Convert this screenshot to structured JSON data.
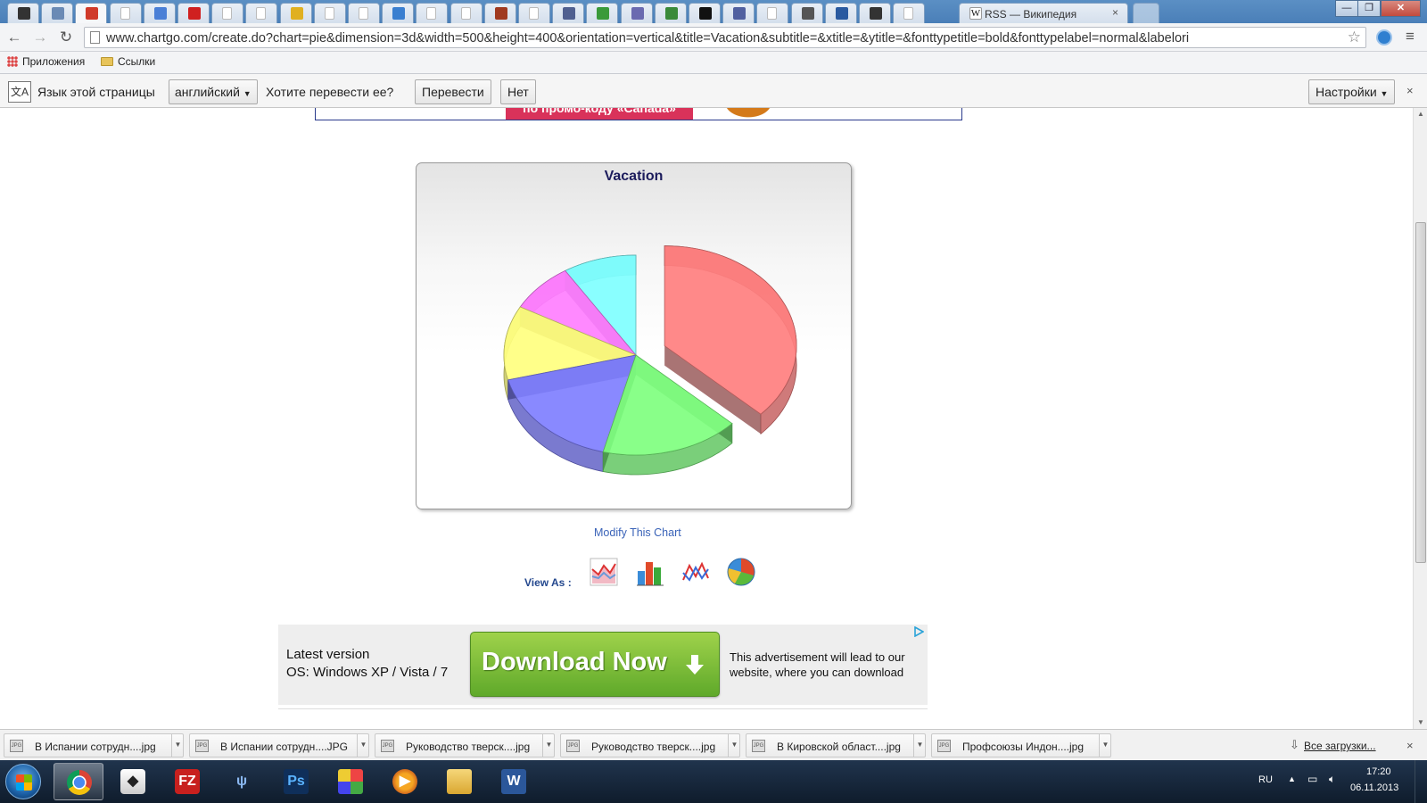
{
  "browser": {
    "tabs": [
      {
        "icon": "github-icon",
        "color": "#333333"
      },
      {
        "icon": "cloud-icon",
        "color": "#6a8ab5"
      },
      {
        "icon": "chartgo-icon",
        "color": "#d03a2a",
        "active": true
      },
      {
        "icon": "page-icon",
        "color": "#bbbbbb"
      },
      {
        "icon": "google-icon",
        "color": "#4a7fd6"
      },
      {
        "icon": "yandex-icon",
        "color": "#d02020"
      },
      {
        "icon": "page-icon",
        "color": "#bbbbbb"
      },
      {
        "icon": "page-icon",
        "color": "#bbbbbb"
      },
      {
        "icon": "yellow-square-icon",
        "color": "#e0b020"
      },
      {
        "icon": "page-icon",
        "color": "#bbbbbb"
      },
      {
        "icon": "page-icon",
        "color": "#bbbbbb"
      },
      {
        "icon": "translate-icon",
        "color": "#3a7fd0"
      },
      {
        "icon": "page-icon",
        "color": "#bbbbbb"
      },
      {
        "icon": "page-icon",
        "color": "#bbbbbb"
      },
      {
        "icon": "grid-icon",
        "color": "#a03a20"
      },
      {
        "icon": "page-icon",
        "color": "#bbbbbb"
      },
      {
        "icon": "php-icon",
        "color": "#506090"
      },
      {
        "icon": "puzzle-icon",
        "color": "#3a9a3a"
      },
      {
        "icon": "php-icon",
        "color": "#6a6ab0"
      },
      {
        "icon": "check-icon",
        "color": "#3a8a3a"
      },
      {
        "icon": "p-icon",
        "color": "#111111"
      },
      {
        "icon": "eye-icon",
        "color": "#5060a0"
      },
      {
        "icon": "page-icon",
        "color": "#bbbbbb"
      },
      {
        "icon": "cloud-icon",
        "color": "#555555"
      },
      {
        "icon": "circle-icon",
        "color": "#2a5aa0"
      },
      {
        "icon": "dark-square-icon",
        "color": "#333333"
      },
      {
        "icon": "page-icon",
        "color": "#bbbbbb"
      }
    ],
    "wiki_tab": {
      "label": "RSS — Википедия",
      "close": "×"
    },
    "url": "www.chartgo.com/create.do?chart=pie&dimension=3d&width=500&height=400&orientation=vertical&title=Vacation&subtitle=&xtitle=&ytitle=&fonttypetitle=bold&fonttypelabel=normal&labelori"
  },
  "bookmarks": {
    "apps": "Приложения",
    "links": "Ссылки"
  },
  "translate_bar": {
    "page_language_label": "Язык этой страницы",
    "language_value": "английский",
    "question": "Хотите перевести ее?",
    "translate_button": "Перевести",
    "no_button": "Нет",
    "settings_button": "Настройки",
    "close": "×"
  },
  "top_banner": {
    "promo_text": "по промо-коду «Canada»"
  },
  "chart_data": {
    "type": "pie",
    "dimension": "3d",
    "title": "Vacation",
    "slices": [
      {
        "value": 37,
        "color": "#ff7f7f",
        "exploded": true
      },
      {
        "value": 17,
        "color": "#7fff7f"
      },
      {
        "value": 17,
        "color": "#7f7fff"
      },
      {
        "value": 12,
        "color": "#ffff7f"
      },
      {
        "value": 8,
        "color": "#ff7fff"
      },
      {
        "value": 9,
        "color": "#7fffff"
      }
    ]
  },
  "page": {
    "modify_link": "Modify This Chart",
    "view_as_label": "View As :",
    "view_as_icons": [
      "area-chart-icon",
      "bar-chart-icon",
      "line-chart-icon",
      "pie-chart-icon"
    ]
  },
  "ad": {
    "line1": "Latest version",
    "line2": "OS: Windows XP / Vista / 7",
    "button": "Download Now",
    "desc1": "This advertisement will lead to our",
    "desc2": "website, where you can download"
  },
  "downloads": {
    "items": [
      "В Испании сотрудн....jpg",
      "В Испании сотрудн....JPG",
      "Руководство тверск....jpg",
      "Руководство тверск....jpg",
      "В Кировской област....jpg",
      "Профсоюзы Индон....jpg"
    ],
    "all_label": "Все загрузки...",
    "close": "×"
  },
  "taskbar": {
    "apps": [
      "chrome-icon",
      "inkscape-icon",
      "filezilla-icon",
      "psi-icon",
      "photoshop-icon",
      "apps-grid-icon",
      "media-player-icon",
      "explorer-icon",
      "word-icon"
    ],
    "lang": "RU",
    "time": "17:20",
    "date": "06.11.2013"
  }
}
